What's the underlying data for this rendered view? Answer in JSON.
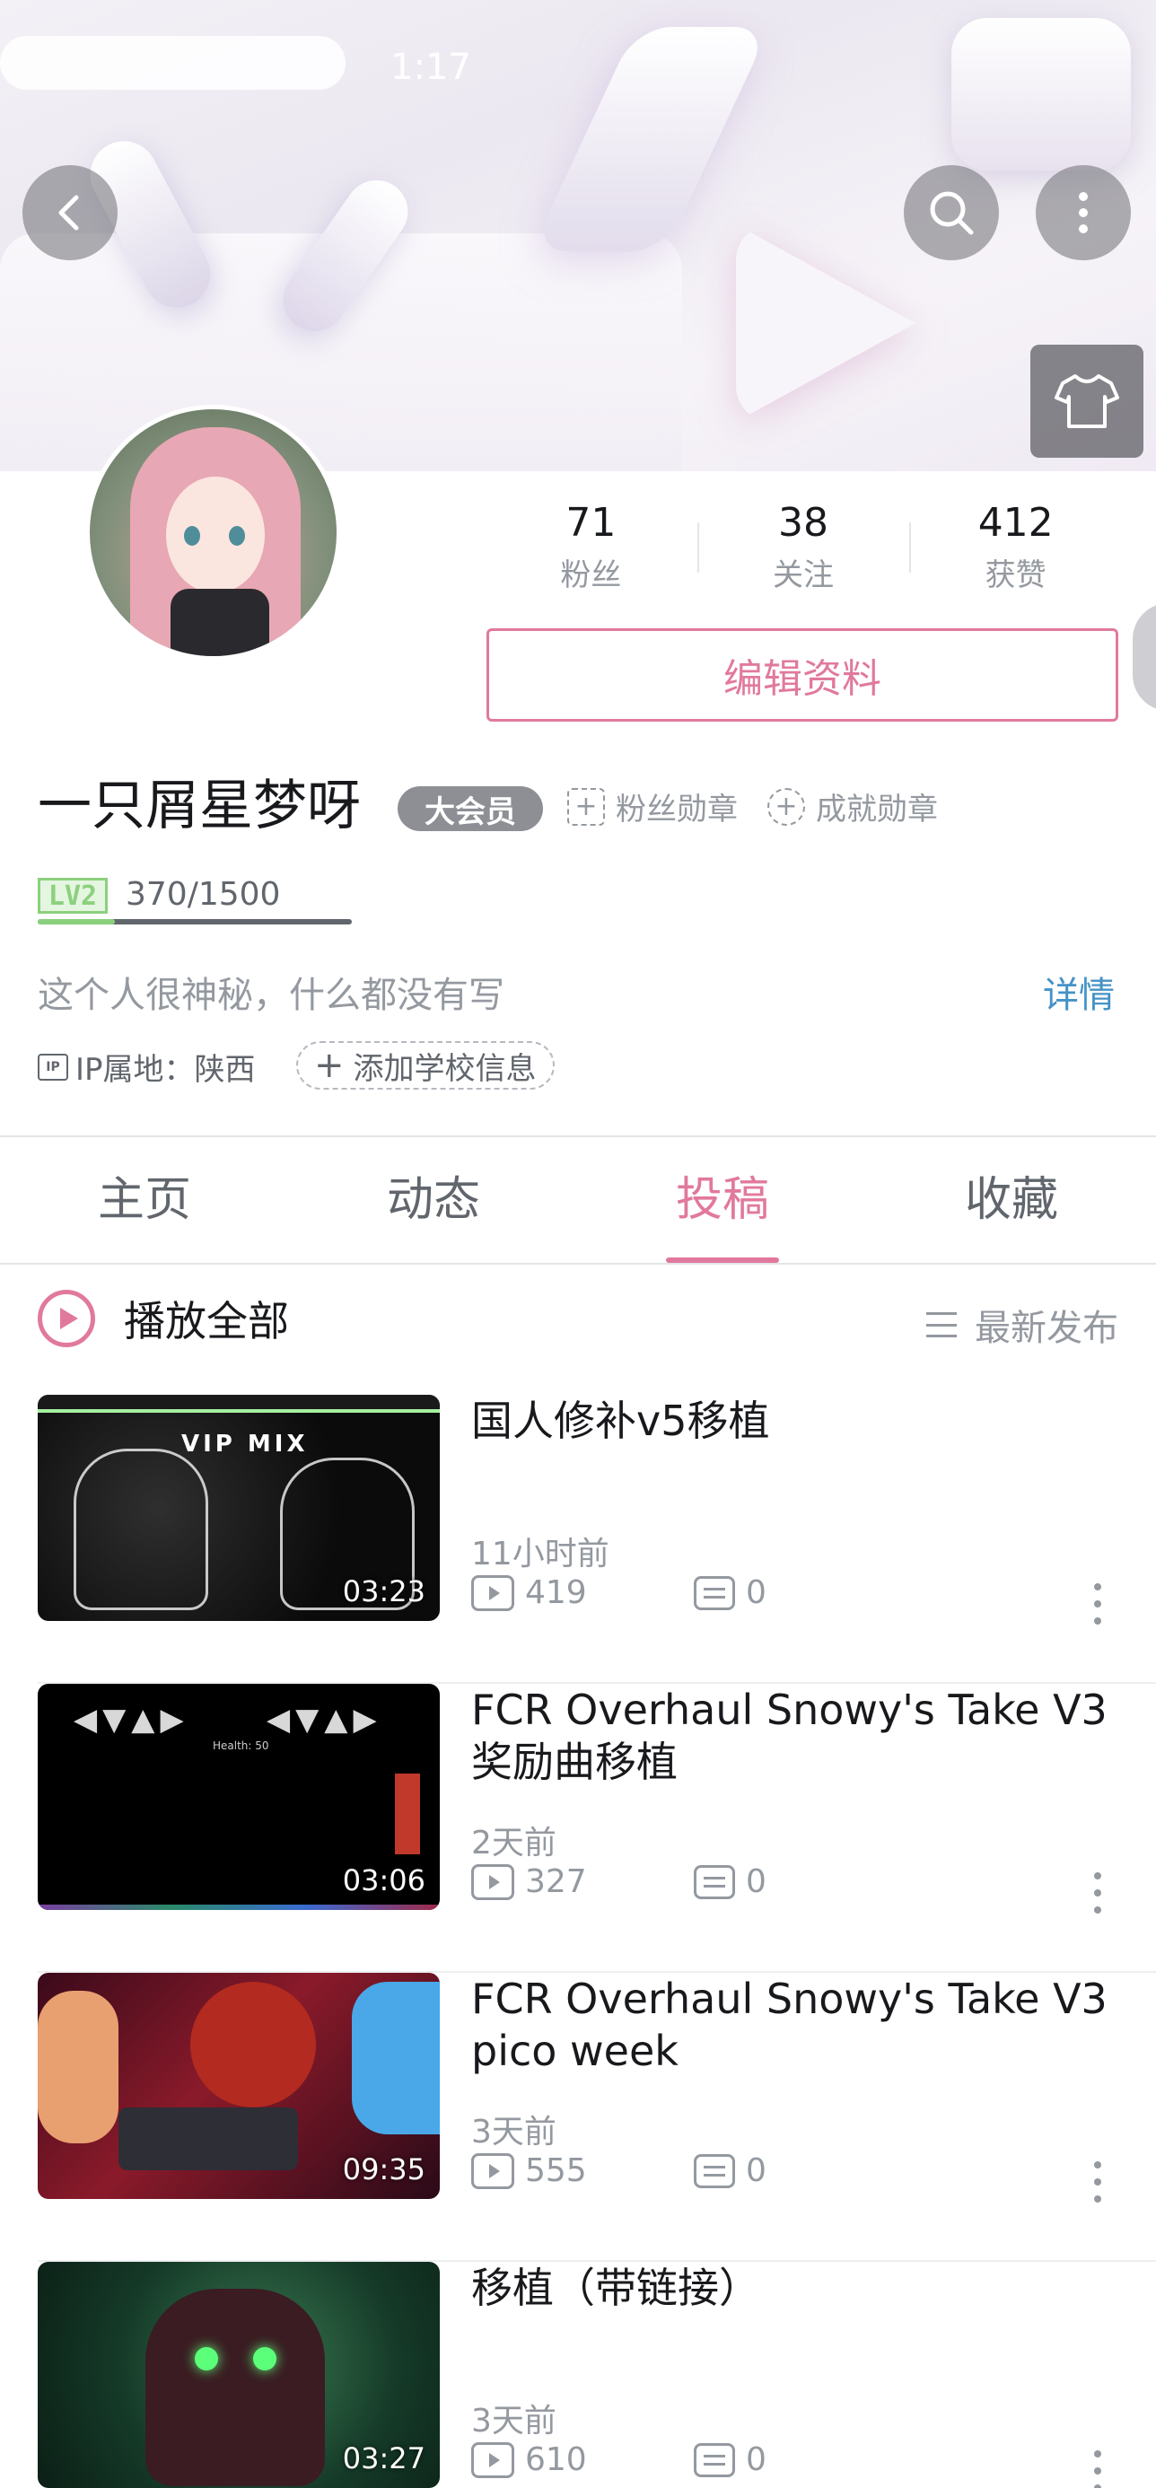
{
  "status_bar": {
    "time": "1:17"
  },
  "header": {
    "back_icon": "chevron-left-icon",
    "search_icon": "search-icon",
    "more_icon": "more-vertical-icon",
    "skin_icon": "tshirt-icon"
  },
  "profile": {
    "stats": [
      {
        "value": "71",
        "label": "粉丝"
      },
      {
        "value": "38",
        "label": "关注"
      },
      {
        "value": "412",
        "label": "获赞"
      }
    ],
    "edit_label": "编辑资料",
    "name": "一只屑星梦呀",
    "vip_badge": "大会员",
    "fan_medal": "粉丝勋章",
    "achievement_medal": "成就勋章",
    "level": "LV2",
    "exp": "370/1500",
    "exp_fraction": 0.2467,
    "bio": "这个人很神秘，什么都没有写",
    "detail_link": "详情",
    "ip_icon_text": "IP",
    "ip_location": "IP属地：陕西",
    "school_button": "添加学校信息"
  },
  "tabs": [
    {
      "label": "主页",
      "active": false
    },
    {
      "label": "动态",
      "active": false
    },
    {
      "label": "投稿",
      "active": true
    },
    {
      "label": "收藏",
      "active": false
    }
  ],
  "list_header": {
    "play_all": "播放全部",
    "sort": "最新发布"
  },
  "videos": [
    {
      "title": "国人修补v5移植",
      "duration": "03:23",
      "time": "11小时前",
      "views": "419",
      "comments": "0",
      "thumb_text": "VIP MIX"
    },
    {
      "title": "FCR Overhaul Snowy's Take V3 奖励曲移植",
      "duration": "03:06",
      "time": "2天前",
      "views": "327",
      "comments": "0",
      "thumb_text": "Health: 50"
    },
    {
      "title": "FCR Overhaul Snowy's Take V3 pico week",
      "duration": "09:35",
      "time": "3天前",
      "views": "555",
      "comments": "0"
    },
    {
      "title": "移植（带链接）",
      "duration": "03:27",
      "time": "3天前",
      "views": "610",
      "comments": "0"
    }
  ],
  "colors": {
    "accent_pink": "#e1799d",
    "link_blue": "#4592c6",
    "level_green": "#8cd07d",
    "text_gray": "#9499a0"
  }
}
